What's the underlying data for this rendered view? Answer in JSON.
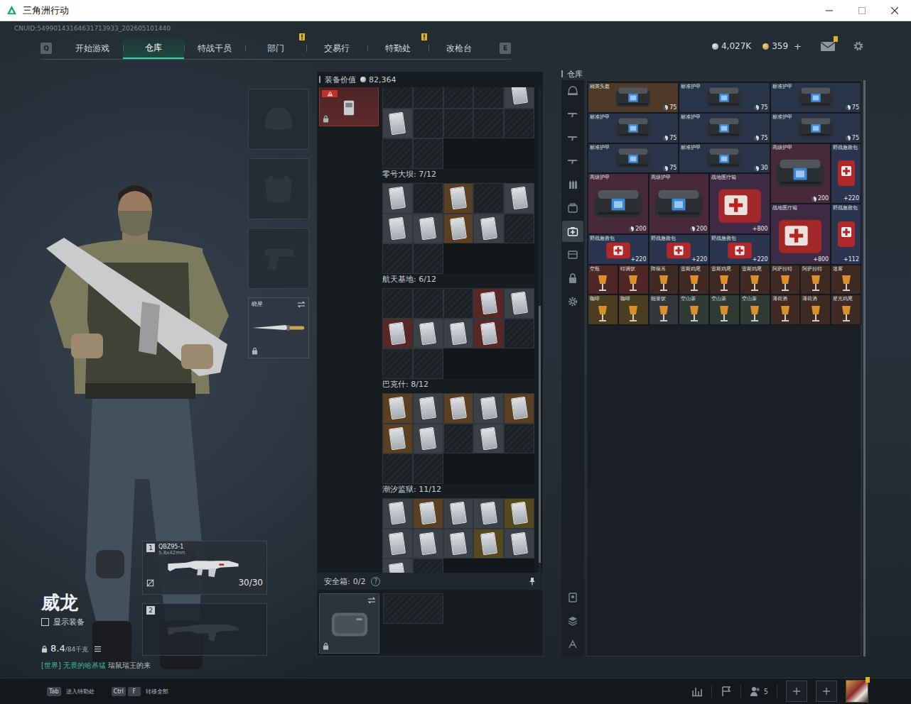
{
  "window": {
    "title": "三角洲行动"
  },
  "uid": "CNUID:54990143164631713933_202605101440",
  "nav": {
    "prev_key": "Q",
    "next_key": "E",
    "tabs": [
      {
        "label": "开始游戏",
        "selected": false,
        "alert": false
      },
      {
        "label": "仓库",
        "selected": true,
        "alert": false
      },
      {
        "label": "特战干员",
        "selected": false,
        "alert": false
      },
      {
        "label": "部门",
        "selected": false,
        "alert": true
      },
      {
        "label": "交易行",
        "selected": false,
        "alert": false
      },
      {
        "label": "特勤处",
        "selected": false,
        "alert": true
      },
      {
        "label": "改枪台",
        "selected": false,
        "alert": false
      }
    ]
  },
  "currency": {
    "silver": "4,027K",
    "gold": "359",
    "add": "+"
  },
  "mail": {
    "alert": true
  },
  "operator": {
    "name": "威龙",
    "show_gear": {
      "label": "显示装备",
      "checked": false
    },
    "weight": "8.4",
    "capacity": "/84千克",
    "chat": {
      "channel": "[世界]",
      "sender": "无畏的哈基猛",
      "message": "瑞鼠瑞王的来"
    }
  },
  "gear_slots": [
    {
      "kind": "helmet",
      "filled": false
    },
    {
      "kind": "armor",
      "filled": false
    },
    {
      "kind": "pistol",
      "filled": false
    },
    {
      "kind": "melee",
      "filled": true,
      "label": "晓星",
      "locked": true,
      "swap": true
    }
  ],
  "weapons": [
    {
      "slot": "1",
      "filled": true,
      "name": "QBZ95-1",
      "ammo": "5.8x42mm",
      "rounds": "30/30"
    },
    {
      "slot": "2",
      "filled": false
    }
  ],
  "loadout": {
    "title": "装备价值",
    "value": "82,364",
    "scroll": {
      "start": 0.45,
      "size": 0.53
    },
    "case": {
      "damaged": true,
      "locked": true
    },
    "sections": [
      {
        "slots": [
          {
            "filled": false
          },
          {
            "filled": false
          },
          {
            "filled": false
          },
          {
            "filled": false
          },
          {
            "filled": true,
            "color": "#3b4047"
          },
          {
            "filled": true,
            "color": "#3b4047"
          },
          {
            "filled": false
          },
          {
            "filled": false
          },
          {
            "filled": false
          },
          {
            "filled": false
          },
          {
            "filled": false
          },
          {
            "filled": false
          }
        ]
      },
      {
        "title": "零号大坝: 7/12",
        "slots": [
          {
            "filled": true,
            "color": "#3b4047"
          },
          {
            "filled": false
          },
          {
            "filled": true,
            "color": "#5b3f22"
          },
          {
            "filled": false
          },
          {
            "filled": true,
            "color": "#3b4047"
          },
          {
            "filled": true,
            "color": "#3b4047"
          },
          {
            "filled": true,
            "color": "#3b4047"
          },
          {
            "filled": true,
            "color": "#5b3f22"
          },
          {
            "filled": true,
            "color": "#3b4047"
          },
          {
            "filled": false
          },
          {
            "filled": false
          },
          {
            "filled": false
          }
        ]
      },
      {
        "title": "航天基地: 6/12",
        "slots": [
          {
            "filled": false
          },
          {
            "filled": false
          },
          {
            "filled": false
          },
          {
            "filled": true,
            "color": "#5a2727"
          },
          {
            "filled": true,
            "color": "#3b4047"
          },
          {
            "filled": true,
            "color": "#5a2727"
          },
          {
            "filled": true,
            "color": "#3b4047"
          },
          {
            "filled": true,
            "color": "#3b4047"
          },
          {
            "filled": true,
            "color": "#5a2727"
          },
          {
            "filled": false
          },
          {
            "filled": false
          },
          {
            "filled": false
          }
        ]
      },
      {
        "title": "巴克什: 8/12",
        "slots": [
          {
            "filled": true,
            "color": "#5b3f22"
          },
          {
            "filled": true,
            "color": "#3b4047"
          },
          {
            "filled": true,
            "color": "#5b3f22"
          },
          {
            "filled": true,
            "color": "#3b4047"
          },
          {
            "filled": true,
            "color": "#5b3f22"
          },
          {
            "filled": true,
            "color": "#5b3f22"
          },
          {
            "filled": true,
            "color": "#3b4047"
          },
          {
            "filled": false
          },
          {
            "filled": true,
            "color": "#3b4047"
          },
          {
            "filled": false
          },
          {
            "filled": false
          },
          {
            "filled": false
          }
        ]
      },
      {
        "title": "潮汐监狱: 11/12",
        "slots": [
          {
            "filled": true,
            "color": "#3b4047"
          },
          {
            "filled": true,
            "color": "#5b3f22"
          },
          {
            "filled": true,
            "color": "#3b4047"
          },
          {
            "filled": true,
            "color": "#3b4047"
          },
          {
            "filled": true,
            "color": "#57491f"
          },
          {
            "filled": true,
            "color": "#3b4047"
          },
          {
            "filled": true,
            "color": "#3b4047"
          },
          {
            "filled": true,
            "color": "#3b4047"
          },
          {
            "filled": true,
            "color": "#57491f"
          },
          {
            "filled": true,
            "color": "#3b4047"
          },
          {
            "filled": true,
            "color": "#3b4047"
          },
          {
            "filled": false
          }
        ]
      }
    ],
    "safe_box": {
      "title": "安全箱:",
      "count": "0/2",
      "help": "?",
      "pinned": true,
      "locked": true,
      "swap": true
    }
  },
  "warehouse": {
    "title": "仓库",
    "side_tabs": [
      {
        "kind": "helmet",
        "selected": false
      },
      {
        "kind": "weapon",
        "selected": false
      },
      {
        "kind": "weapon",
        "selected": false
      },
      {
        "kind": "weapon",
        "selected": false
      },
      {
        "kind": "ammo",
        "selected": false
      },
      {
        "kind": "bag",
        "selected": false
      },
      {
        "kind": "medical",
        "selected": true
      },
      {
        "kind": "item",
        "selected": false
      },
      {
        "kind": "lock",
        "selected": false
      },
      {
        "kind": "settings",
        "selected": false
      }
    ],
    "bottom_tabs": [
      {
        "kind": "sort",
        "selected": false
      },
      {
        "kind": "stack",
        "selected": false
      },
      {
        "kind": "tidy",
        "selected": false
      }
    ],
    "scroll": {
      "start": 0,
      "size": 1
    },
    "items": [
      {
        "kind": "helmet",
        "name": "精英头盔",
        "value": "75",
        "color": "#4e3a26"
      },
      {
        "kind": "armor",
        "name": "标准护甲",
        "value": "75",
        "color": "#2a3448"
      },
      {
        "kind": "armor",
        "name": "标准护甲",
        "value": "75",
        "color": "#2a3448"
      },
      {
        "kind": "armor",
        "name": "标准护甲",
        "value": "75",
        "color": "#2a3448"
      },
      {
        "kind": "armor",
        "name": "标准护甲",
        "value": "75",
        "color": "#2a3448"
      },
      {
        "kind": "armor",
        "name": "标准护甲",
        "value": "75",
        "color": "#2a3448"
      },
      {
        "kind": "armor",
        "name": "标准护甲",
        "value": "75",
        "color": "#2a3448"
      },
      {
        "kind": "armor",
        "name": "标准护甲",
        "value": "30",
        "color": "#2a3448"
      },
      {
        "kind": "large-armor",
        "name": "高级护甲",
        "value": "200",
        "color": "#47293a"
      },
      {
        "kind": "firstaid",
        "name": "野战急救包",
        "value": "+220",
        "color": "#2c3550"
      },
      {
        "kind": "large-armor",
        "name": "高级护甲",
        "value": "200",
        "color": "#47293a"
      },
      {
        "kind": "large-armor",
        "name": "高级护甲",
        "value": "200",
        "color": "#47293a"
      },
      {
        "kind": "medbox",
        "name": "战地医疗箱",
        "value": "+800",
        "color": "#3f2a45"
      },
      {
        "kind": "medbox",
        "name": "战地医疗箱",
        "value": "+800",
        "color": "#3f2a45"
      },
      {
        "kind": "firstaid",
        "name": "野战急救包",
        "value": "+112",
        "color": "#2c3550"
      },
      {
        "kind": "firstaid-h",
        "name": "野战急救包",
        "value": "+220",
        "color": "#2c3550"
      },
      {
        "kind": "firstaid-h",
        "name": "野战急救包",
        "value": "+220",
        "color": "#2c3550"
      },
      {
        "kind": "firstaid-h",
        "name": "野战急救包",
        "value": "+220",
        "color": "#2c3550"
      },
      {
        "kind": "drink",
        "name": "空瓶",
        "color": "#4f2626"
      },
      {
        "kind": "drink",
        "name": "特调饮",
        "color": "#4f2626"
      },
      {
        "kind": "drink",
        "name": "降噪耳",
        "color": "#3e2a22"
      },
      {
        "kind": "drink",
        "name": "雷斯鸡尾",
        "color": "#3e2a22"
      },
      {
        "kind": "drink",
        "name": "雷斯鸡尾",
        "color": "#3e2a22"
      },
      {
        "kind": "drink",
        "name": "雷斯鸡尾",
        "color": "#3e2a22"
      },
      {
        "kind": "drink",
        "name": "阿萨拉特",
        "color": "#3e2a22"
      },
      {
        "kind": "drink",
        "name": "阿萨拉特",
        "color": "#3e2a22"
      },
      {
        "kind": "drink",
        "name": "迷雾",
        "color": "#3e2a22"
      },
      {
        "kind": "drink",
        "name": "咖啡",
        "color": "#4a3d22"
      },
      {
        "kind": "drink",
        "name": "咖啡",
        "color": "#4a3d22"
      },
      {
        "kind": "drink",
        "name": "能量饮",
        "color": "#33373c"
      },
      {
        "kind": "drink",
        "name": "空山茶",
        "color": "#2e3a33"
      },
      {
        "kind": "drink",
        "name": "空山茶",
        "color": "#2e3a33"
      },
      {
        "kind": "drink",
        "name": "空山茶",
        "color": "#2e3a33"
      },
      {
        "kind": "drink",
        "name": "薄荷酒",
        "color": "#3e2a22"
      },
      {
        "kind": "drink",
        "name": "薄荷酒",
        "color": "#3e2a22"
      },
      {
        "kind": "drink",
        "name": "星光鸡尾",
        "color": "#3e2a22"
      }
    ]
  },
  "bottom_bar": {
    "hints": [
      {
        "keys": [
          "Tab"
        ],
        "label": "进入特勤处"
      },
      {
        "keys": [
          "Ctrl",
          "F"
        ],
        "label": "转移全部"
      }
    ],
    "friends": "5",
    "party": [
      {
        "filled": false
      },
      {
        "filled": false
      }
    ],
    "avatar_alert": true
  }
}
